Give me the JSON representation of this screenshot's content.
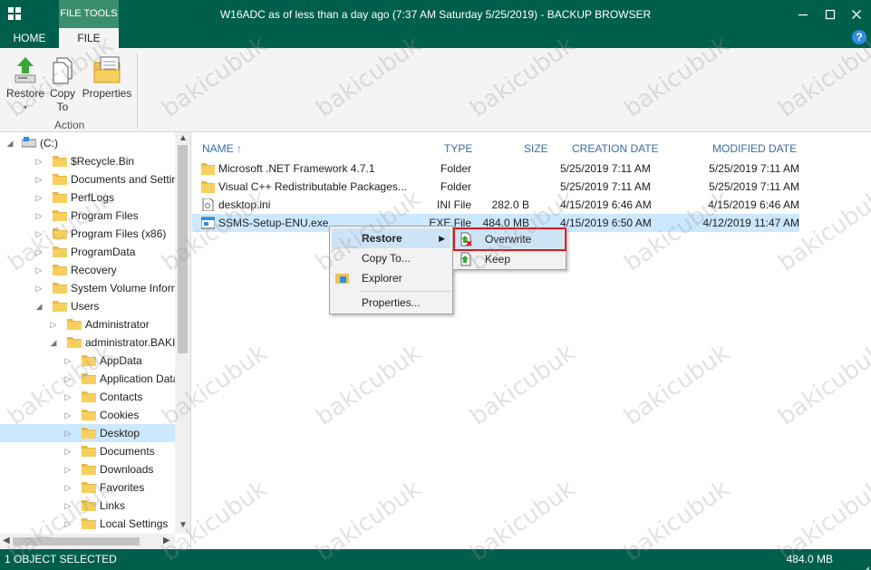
{
  "window": {
    "title": "W16ADC as of less than a day ago (7:37 AM Saturday 5/25/2019) - BACKUP BROWSER",
    "context_tab": "FILE TOOLS",
    "controls": [
      "minimize",
      "maximize",
      "close"
    ]
  },
  "ribbon": {
    "tabs": [
      {
        "label": "HOME",
        "active": false
      },
      {
        "label": "FILE",
        "active": true
      }
    ],
    "help_label": "?",
    "buttons": {
      "restore": "Restore",
      "copy_to": "Copy\nTo",
      "copy_line1": "Copy",
      "copy_line2": "To",
      "properties": "Properties"
    },
    "group_label": "Action"
  },
  "tree": {
    "items": [
      {
        "label": "(C:)",
        "level": 0,
        "expanded": true,
        "icon": "drive-icon"
      },
      {
        "label": "$Recycle.Bin",
        "level": 1,
        "expanded": false
      },
      {
        "label": "Documents and Settings",
        "level": 1,
        "expanded": false
      },
      {
        "label": "PerfLogs",
        "level": 1,
        "expanded": false
      },
      {
        "label": "Program Files",
        "level": 1,
        "expanded": false
      },
      {
        "label": "Program Files (x86)",
        "level": 1,
        "expanded": false
      },
      {
        "label": "ProgramData",
        "level": 1,
        "expanded": false
      },
      {
        "label": "Recovery",
        "level": 1,
        "expanded": false
      },
      {
        "label": "System Volume Informati",
        "level": 1,
        "expanded": false
      },
      {
        "label": "Users",
        "level": 1,
        "expanded": true
      },
      {
        "label": "Administrator",
        "level": 2,
        "expanded": false
      },
      {
        "label": "administrator.BAKICU",
        "level": 2,
        "expanded": true
      },
      {
        "label": "AppData",
        "level": 3,
        "expanded": false
      },
      {
        "label": "Application Data",
        "level": 3,
        "expanded": false
      },
      {
        "label": "Contacts",
        "level": 3,
        "expanded": false
      },
      {
        "label": "Cookies",
        "level": 3,
        "expanded": false
      },
      {
        "label": "Desktop",
        "level": 3,
        "expanded": false,
        "selected": true
      },
      {
        "label": "Documents",
        "level": 3,
        "expanded": false
      },
      {
        "label": "Downloads",
        "level": 3,
        "expanded": false
      },
      {
        "label": "Favorites",
        "level": 3,
        "expanded": false
      },
      {
        "label": "Links",
        "level": 3,
        "expanded": false
      },
      {
        "label": "Local Settings",
        "level": 3,
        "expanded": false
      }
    ]
  },
  "filelist": {
    "columns": {
      "name": "NAME",
      "sort_icon": "↑",
      "type": "TYPE",
      "size": "SIZE",
      "created": "CREATION DATE",
      "modified": "MODIFIED DATE"
    },
    "rows": [
      {
        "name": "Microsoft .NET Framework 4.7.1",
        "type": "Folder",
        "size": "",
        "created": "5/25/2019 7:11 AM",
        "modified": "5/25/2019 7:11 AM",
        "icon": "folder-icon"
      },
      {
        "name": "Visual C++ Redistributable Packages...",
        "type": "Folder",
        "size": "",
        "created": "5/25/2019 7:11 AM",
        "modified": "5/25/2019 7:11 AM",
        "icon": "folder-icon"
      },
      {
        "name": "desktop.ini",
        "type": "INI File",
        "size": "282.0 B",
        "created": "4/15/2019 6:46 AM",
        "modified": "4/15/2019 6:46 AM",
        "icon": "ini-file-icon"
      },
      {
        "name": "SSMS-Setup-ENU.exe",
        "type": "EXE File",
        "size": "484.0 MB",
        "created": "4/15/2019 6:50 AM",
        "modified": "4/12/2019 11:47 AM",
        "icon": "exe-file-icon",
        "selected": true
      }
    ]
  },
  "context_menu": {
    "items": [
      "Restore",
      "Copy To...",
      "Explorer",
      "Properties..."
    ],
    "submenu": [
      "Overwrite",
      "Keep"
    ]
  },
  "statusbar": {
    "left": "1 OBJECT SELECTED",
    "right": "484.0 MB"
  },
  "watermark": "bakicubuk",
  "colors": {
    "brand": "#005f4b",
    "selection": "#cce8ff",
    "header_text": "#3a6ea5",
    "highlight_border": "#e0161e"
  }
}
